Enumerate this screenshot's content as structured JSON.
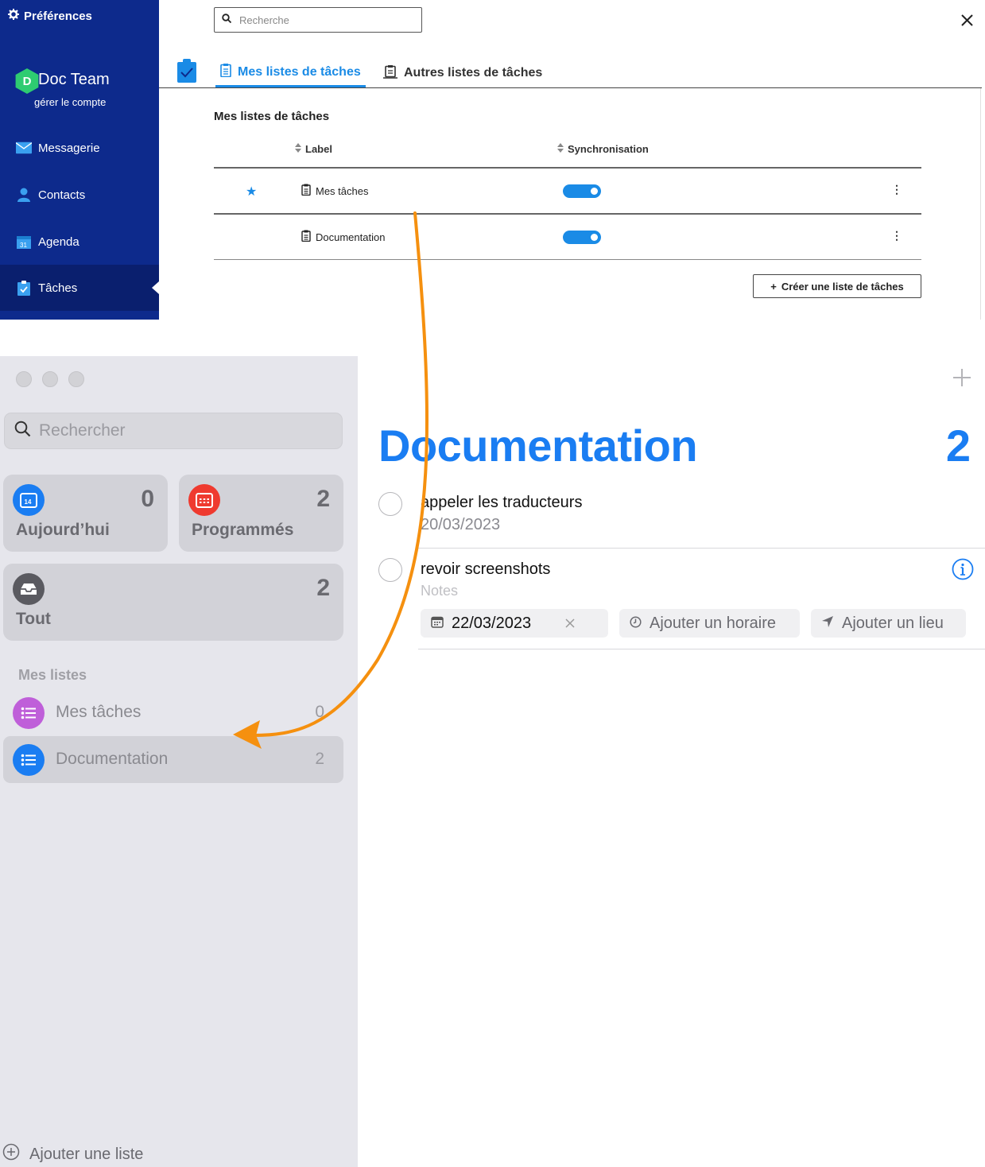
{
  "web": {
    "sidebar": {
      "preferences_label": "Préférences",
      "account": {
        "avatar_letter": "D",
        "team_name": "Doc Team",
        "manage_label": "gérer le compte"
      },
      "nav": [
        {
          "label": "Messagerie",
          "icon": "mail-icon"
        },
        {
          "label": "Contacts",
          "icon": "person-icon"
        },
        {
          "label": "Agenda",
          "icon": "calendar-icon"
        },
        {
          "label": "Tâches",
          "icon": "clipboard-check-icon",
          "active": true
        }
      ]
    },
    "search": {
      "placeholder": "Recherche"
    },
    "tabs": [
      {
        "label": "Mes listes de tâches",
        "active": true
      },
      {
        "label": "Autres listes de tâches",
        "active": false
      }
    ],
    "section_title": "Mes listes de tâches",
    "columns": {
      "label": "Label",
      "sync": "Synchronisation"
    },
    "rows": [
      {
        "label": "Mes tâches",
        "starred": true,
        "sync_on": true
      },
      {
        "label": "Documentation",
        "starred": false,
        "sync_on": true
      }
    ],
    "create_button": "Créer une liste de tâches",
    "colors": {
      "sidebar": "#0d2a8c",
      "accent": "#1a8be6"
    }
  },
  "mac": {
    "search": {
      "placeholder": "Rechercher"
    },
    "smart_lists": [
      {
        "label": "Aujourd’hui",
        "count": "0",
        "icon": "calendar-today-icon",
        "icon_text": "14",
        "color": "#1a7df2"
      },
      {
        "label": "Programmés",
        "count": "2",
        "icon": "calendar-scheduled-icon",
        "color": "#ef3a2f"
      },
      {
        "label": "Tout",
        "count": "2",
        "icon": "tray-icon",
        "color": "#5a5a60"
      }
    ],
    "my_lists_heading": "Mes listes",
    "lists": [
      {
        "name": "Mes tâches",
        "count": "0",
        "color": "#bf5fd9"
      },
      {
        "name": "Documentation",
        "count": "2",
        "color": "#1a7df2",
        "selected": true
      }
    ],
    "add_list_label": "Ajouter une liste",
    "main": {
      "title": "Documentation",
      "count": "2",
      "tasks": [
        {
          "title": "appeler les traducteurs",
          "date": "20/03/2023"
        },
        {
          "title": "revoir screenshots",
          "notes_placeholder": "Notes",
          "date_chip": "22/03/2023",
          "time_chip": "Ajouter un horaire",
          "place_chip": "Ajouter un lieu"
        }
      ]
    },
    "colors": {
      "accent": "#1a7df2",
      "arrow": "#f5900f"
    }
  }
}
